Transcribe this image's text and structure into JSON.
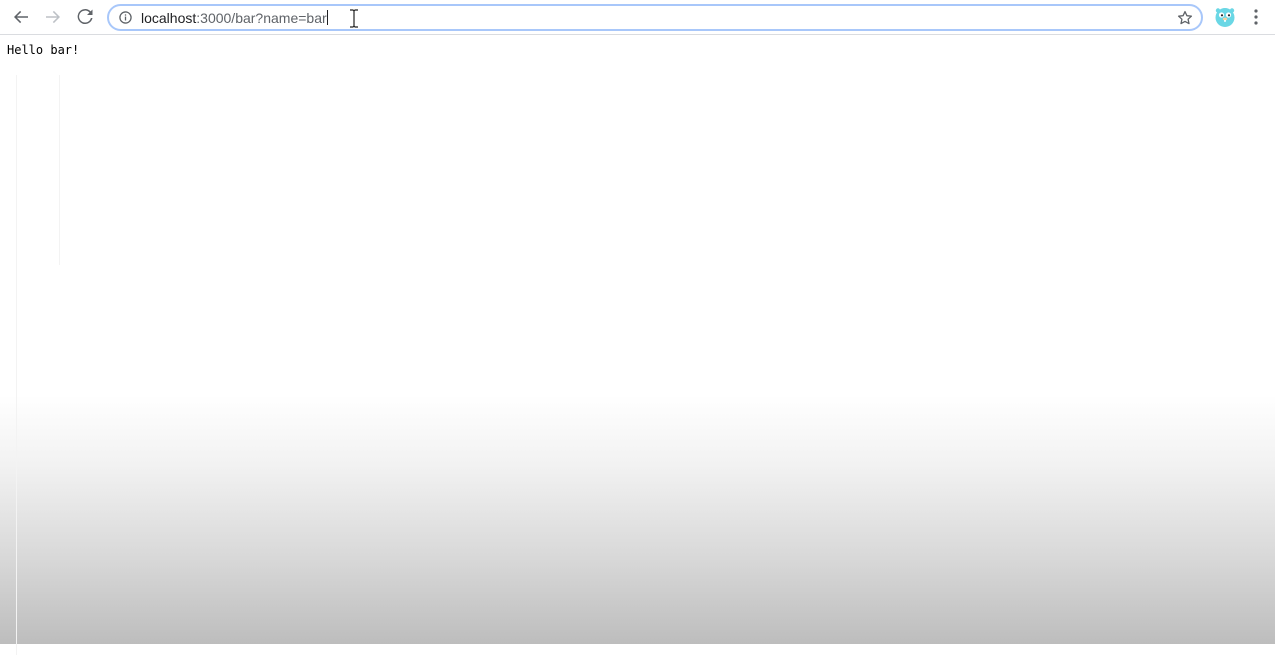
{
  "browser": {
    "nav": {
      "back_icon": "arrow-left-icon",
      "forward_icon": "arrow-right-icon",
      "reload_icon": "reload-icon"
    },
    "omnibox": {
      "info_icon": "info-icon",
      "url_host": "localhost",
      "url_path": ":3000/bar?name=bar",
      "bookmark_icon": "star-icon",
      "focus_color": "#a8c7fa"
    },
    "extension_icon": "gopher-extension-icon",
    "menu_icon": "vertical-dots-menu-icon"
  },
  "page": {
    "greeting": "Hello bar!"
  }
}
